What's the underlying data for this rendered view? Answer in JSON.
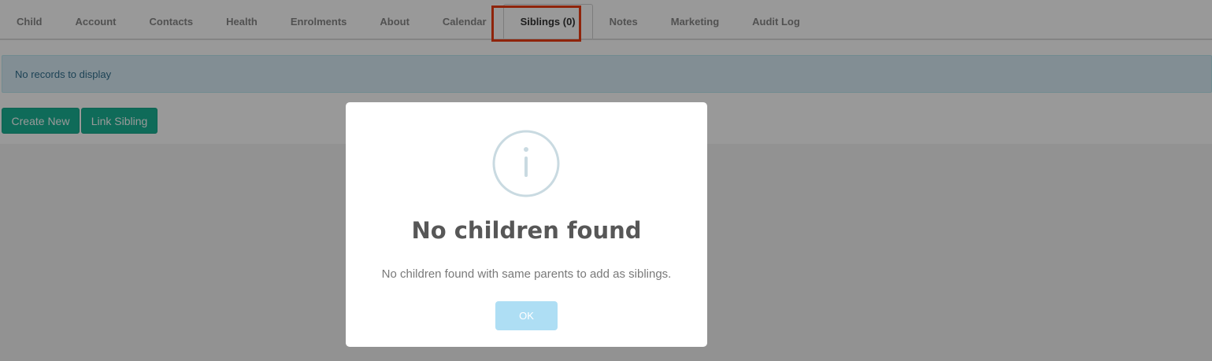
{
  "tabs": [
    {
      "label": "Child"
    },
    {
      "label": "Account"
    },
    {
      "label": "Contacts"
    },
    {
      "label": "Health"
    },
    {
      "label": "Enrolments"
    },
    {
      "label": "About"
    },
    {
      "label": "Calendar"
    },
    {
      "label": "Siblings (0)",
      "active": true
    },
    {
      "label": "Notes"
    },
    {
      "label": "Marketing"
    },
    {
      "label": "Audit Log"
    }
  ],
  "alert": {
    "text": "No records to display"
  },
  "actions": {
    "create_label": "Create New",
    "link_label": "Link Sibling"
  },
  "modal": {
    "icon": "info-icon",
    "title": "No children found",
    "text": "No children found with same parents to add as siblings.",
    "ok_label": "OK"
  },
  "colors": {
    "primary": "#1ab394",
    "highlight": "#ee3c13",
    "ok_button": "#aedef4",
    "alert_bg": "#d9edf7"
  }
}
